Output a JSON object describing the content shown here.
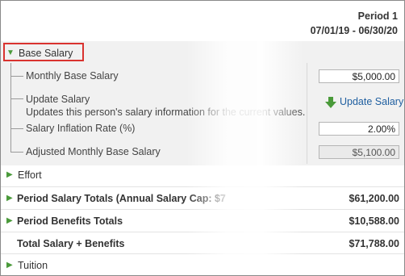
{
  "header": {
    "period": "Period 1",
    "dates": "07/01/19 - 06/30/20"
  },
  "base_salary": {
    "title": "Base Salary",
    "monthly_label": "Monthly Base Salary",
    "monthly_value": "$5,000.00",
    "update_title": "Update Salary",
    "update_desc": "Updates this person's salary information for the current values.",
    "update_button": "Update Salary",
    "inflation_label": "Salary Inflation Rate (%)",
    "inflation_value": "2.00%",
    "adjusted_label": "Adjusted Monthly Base Salary",
    "adjusted_value": "$5,100.00"
  },
  "rows": {
    "effort": "Effort",
    "salary_totals": "Period Salary Totals (Annual Salary Cap: $7",
    "salary_totals_value": "$61,200.00",
    "benefits_totals": "Period Benefits Totals",
    "benefits_totals_value": "$10,588.00",
    "total": "Total Salary + Benefits",
    "total_value": "$71,788.00",
    "tuition": "Tuition"
  },
  "colors": {
    "highlight": "#d9332f",
    "link": "#1f5fa0",
    "arrow": "#4a9a3a"
  }
}
